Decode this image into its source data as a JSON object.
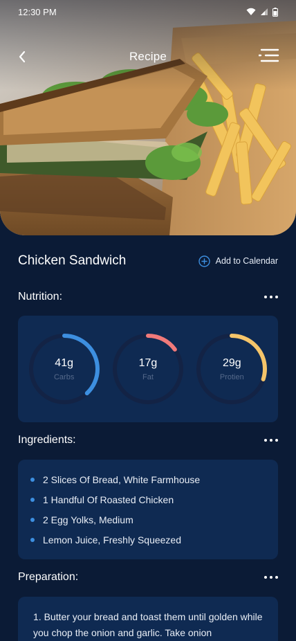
{
  "status_bar": {
    "time": "12:30 PM"
  },
  "header": {
    "title": "Recipe"
  },
  "recipe": {
    "title": "Chicken Sandwich",
    "add_to_calendar": "Add to Calendar"
  },
  "nutrition": {
    "title": "Nutrition:",
    "items": [
      {
        "value": "41g",
        "label": "Carbs",
        "progress": 0.38,
        "color": "#3d8fe0"
      },
      {
        "value": "17g",
        "label": "Fat",
        "progress": 0.15,
        "color": "#f07a7a"
      },
      {
        "value": "29g",
        "label": "Protien",
        "progress": 0.3,
        "color": "#f5c56a"
      }
    ]
  },
  "ingredients": {
    "title": "Ingredients:",
    "items": [
      "2 Slices Of Bread, White Farmhouse",
      "1 Handful Of Roasted Chicken",
      "2 Egg Yolks, Medium",
      "Lemon Juice, Freshly Squeezed"
    ]
  },
  "preparation": {
    "title": "Preparation:",
    "text": "1. Butter your bread and toast them until golden while you chop the onion and garlic. Take onion"
  },
  "colors": {
    "background": "#0b1b36",
    "card": "#0f2a52",
    "accent": "#3d8fe0"
  }
}
